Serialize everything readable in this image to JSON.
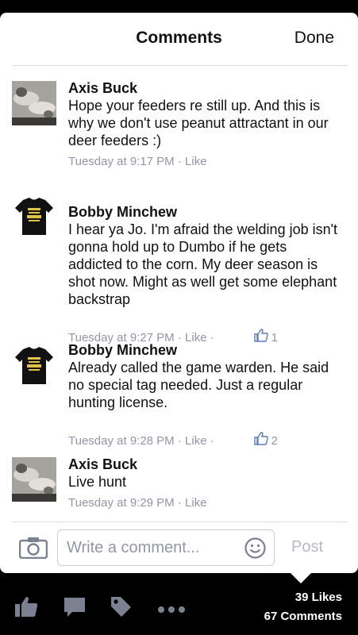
{
  "header": {
    "title": "Comments",
    "done_label": "Done"
  },
  "comments": [
    {
      "author": "Axis Buck",
      "text": "Hope your feeders re still up. And this is why we don't use peanut attractant in our deer feeders :)",
      "time": "Tuesday at 9:17 PM",
      "like_label": "Like",
      "like_count": ""
    },
    {
      "author": "Bobby Minchew",
      "text": "I hear ya Jo.  I'm afraid the welding job isn't gonna hold up to Dumbo if he gets addicted to the corn.    My deer season is shot now.  Might as well get some elephant backstrap",
      "time": "Tuesday at 9:27 PM",
      "like_label": "Like",
      "like_count": "1"
    },
    {
      "author": "Bobby Minchew",
      "text": "Already called the game warden.  He said no special tag needed.   Just a regular hunting license.",
      "time": "Tuesday at 9:28 PM",
      "like_label": "Like",
      "like_count": "2"
    },
    {
      "author": "Axis Buck",
      "text": "Live hunt",
      "time": "Tuesday at 9:29 PM",
      "like_label": "Like",
      "like_count": ""
    }
  ],
  "composer": {
    "placeholder": "Write a comment...",
    "post_label": "Post"
  },
  "footer": {
    "likes": "39 Likes",
    "comments": "67 Comments"
  },
  "colors": {
    "accent": "#5b7bb4",
    "meta": "#9197a3",
    "bar": "#000000"
  }
}
